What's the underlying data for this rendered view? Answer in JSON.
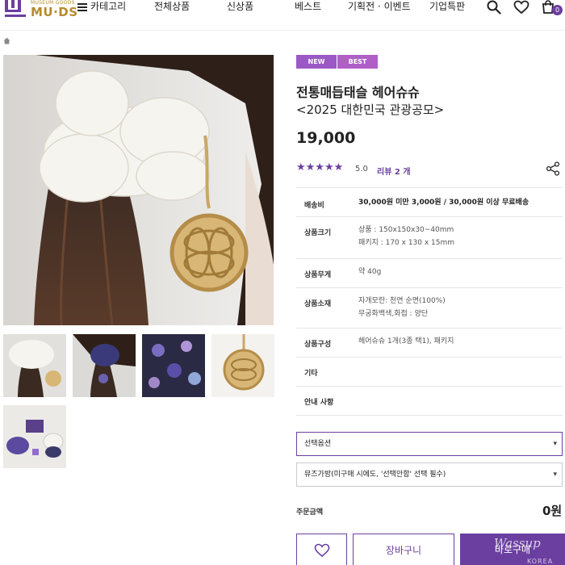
{
  "header": {
    "logo": {
      "sub": "MUSEUM GOODS",
      "main": "MU·DS"
    },
    "nav": [
      {
        "label": "카테고리"
      },
      {
        "label": "전체상품"
      },
      {
        "label": "신상품"
      },
      {
        "label": "베스트"
      },
      {
        "label": "기획전 · 이벤트"
      },
      {
        "label": "기업특판"
      }
    ],
    "icons": [
      "search-icon",
      "heart-icon",
      "cart-icon"
    ],
    "cart_count": "0"
  },
  "breadcrumb": {
    "icon": "home-icon"
  },
  "gallery": {
    "thumbnail_count": 5
  },
  "product": {
    "badges": [
      {
        "label": "NEW",
        "color": "#9b59c6"
      },
      {
        "label": "BEST",
        "color": "#b05fc7"
      }
    ],
    "title_line1": "전통매듭태슬 헤어슈슈",
    "title_line2": "<2025 대한민국 관광공모>",
    "price": "19,000",
    "stars": "★★★★★",
    "rating": "5.0",
    "review_link": "리뷰 2 개",
    "info": [
      {
        "label": "배송비",
        "lines": [
          "30,000원 미만 3,000원 / 30,000원 이상 무료배송"
        ]
      },
      {
        "label": "상품크기",
        "lines": [
          "상품 : 150x150x30~40mm",
          "패키지 : 170 x 130 x 15mm"
        ]
      },
      {
        "label": "상품무게",
        "lines": [
          "약 40g"
        ]
      },
      {
        "label": "상품소재",
        "lines": [
          "자개모란: 천연 순면(100%)",
          "무궁화백색,화접 : 양단"
        ]
      },
      {
        "label": "상품구성",
        "lines": [
          "헤어슈슈 1개(3종 택1), 패키지"
        ]
      },
      {
        "label": "기타",
        "lines": []
      },
      {
        "label": "안내 사항",
        "lines": []
      }
    ],
    "select_option": "선택옵션",
    "select_bag": "뮤즈가방(미구매 시에도, '선택안함' 선택 필수)",
    "total_label": "주문금액",
    "total_value": "0원",
    "buttons": {
      "cart": "장바구니",
      "buy": "바로구매"
    },
    "watermark": {
      "main": "Wassup",
      "sub": "KOREA"
    }
  },
  "colors": {
    "brand_purple": "#6b3fa0",
    "brand_gold": "#b78a2e"
  }
}
